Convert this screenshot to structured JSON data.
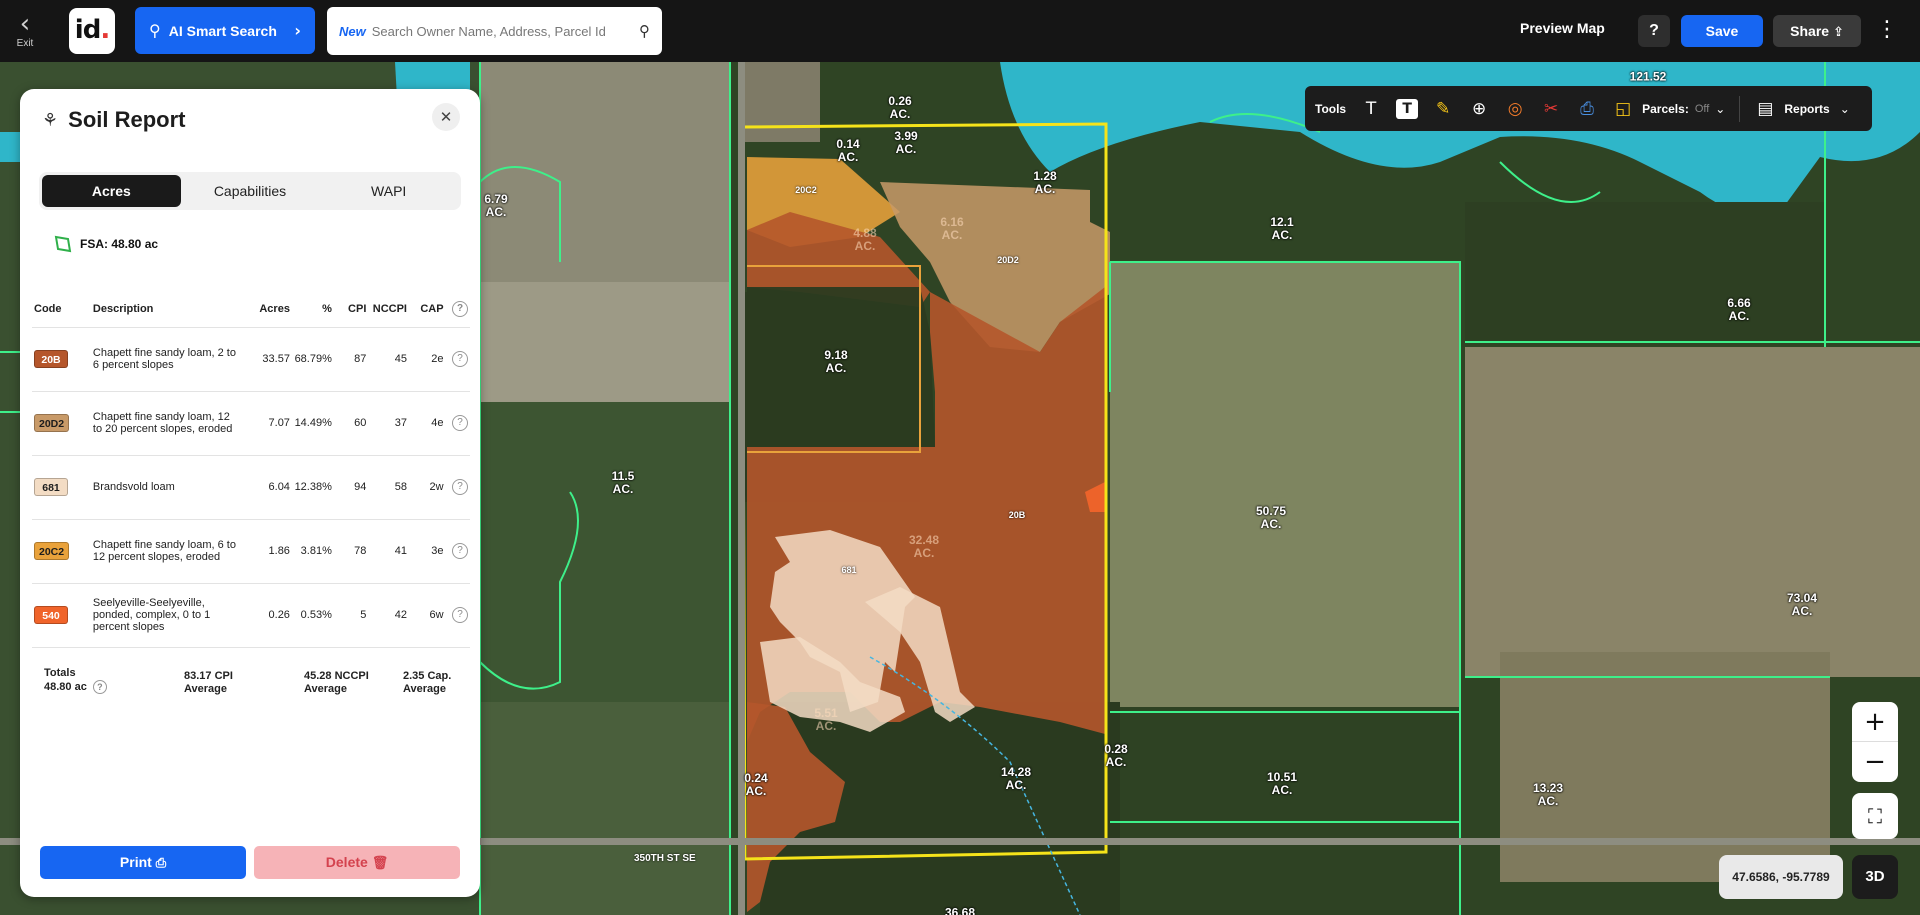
{
  "topbar": {
    "exit_label": "Exit",
    "logo_text": "id",
    "ai_search_label": "AI Smart Search",
    "search_new_tag": "New",
    "search_placeholder": "Search Owner Name, Address, Parcel Id",
    "preview_map_label": "Preview Map",
    "help_label": "?",
    "save_label": "Save",
    "share_label": "Share"
  },
  "tools": {
    "label": "Tools",
    "parcels_label": "Parcels:",
    "parcels_state": "Off",
    "reports_label": "Reports"
  },
  "map": {
    "acreage_labels": [
      "0.26\nAC.",
      "0.14\nAC.",
      "3.99\nAC.",
      "1.28\nAC.",
      "121.52",
      "6.79\nAC.",
      "12.1\nAC.",
      "6.66\nAC.",
      "9.18\nAC.",
      "11.5\nAC.",
      "50.75\nAC.",
      "73.04\nAC.",
      "14.28\nAC.",
      "10.51\nAC.",
      "13.23\nAC.",
      "0.24\nAC.",
      "0.28\nAC.",
      "36.68"
    ],
    "soil_labels": [
      "20C2",
      "20D2",
      "20B",
      "681"
    ],
    "faded_labels": [
      "4.88\nAC.",
      "6.16\nAC.",
      "32.48\nAC.",
      "5.51\nAC."
    ],
    "road_label": "350TH ST SE"
  },
  "controls": {
    "zoom_in": "+",
    "zoom_out": "−",
    "coordinates": "47.6586, -95.7789",
    "btn_3d": "3D"
  },
  "panel": {
    "title": "Soil Report",
    "tabs": [
      "Acres",
      "Capabilities",
      "WAPI"
    ],
    "active_tab": "Acres",
    "fsa_label": "FSA: 48.80 ac",
    "columns": [
      "Code",
      "Description",
      "Acres",
      "%",
      "CPI",
      "NCCPI",
      "CAP"
    ],
    "rows": [
      {
        "code": "20B",
        "color": "#b5562b",
        "text_color": "#ffffff",
        "description": "Chapett fine sandy loam, 2 to 6 percent slopes",
        "acres": "33.57",
        "pct": "68.79%",
        "cpi": "87",
        "nccpi": "45",
        "cap": "2e"
      },
      {
        "code": "20D2",
        "color": "#c89a68",
        "text_color": "#1d1d1d",
        "description": "Chapett fine sandy loam, 12 to 20 percent slopes, eroded",
        "acres": "7.07",
        "pct": "14.49%",
        "cpi": "60",
        "nccpi": "37",
        "cap": "4e"
      },
      {
        "code": "681",
        "color": "#f3dcc4",
        "text_color": "#1d1d1d",
        "description": "Brandsvold loam",
        "acres": "6.04",
        "pct": "12.38%",
        "cpi": "94",
        "nccpi": "58",
        "cap": "2w"
      },
      {
        "code": "20C2",
        "color": "#e9a23b",
        "text_color": "#1d1d1d",
        "description": "Chapett fine sandy loam, 6 to 12 percent slopes, eroded",
        "acres": "1.86",
        "pct": "3.81%",
        "cpi": "78",
        "nccpi": "41",
        "cap": "3e"
      },
      {
        "code": "540",
        "color": "#f0642a",
        "text_color": "#ffffff",
        "description": "Seelyeville-Seelyeville, ponded, complex, 0 to 1 percent slopes",
        "acres": "0.26",
        "pct": "0.53%",
        "cpi": "5",
        "nccpi": "42",
        "cap": "6w"
      }
    ],
    "totals": {
      "label": "Totals",
      "acres": "48.80 ac",
      "cpi": "83.17 CPI",
      "cpi_sub": "Average",
      "nccpi": "45.28 NCCPI",
      "nccpi_sub": "Average",
      "cap": "2.35 Cap.",
      "cap_sub": "Average"
    },
    "print_label": "Print",
    "delete_label": "Delete"
  },
  "colors": {
    "accent": "#1766f2",
    "parcel_line": "#3ef08a",
    "field_outline": "#f5e31a",
    "water": "#2fb6c9"
  }
}
